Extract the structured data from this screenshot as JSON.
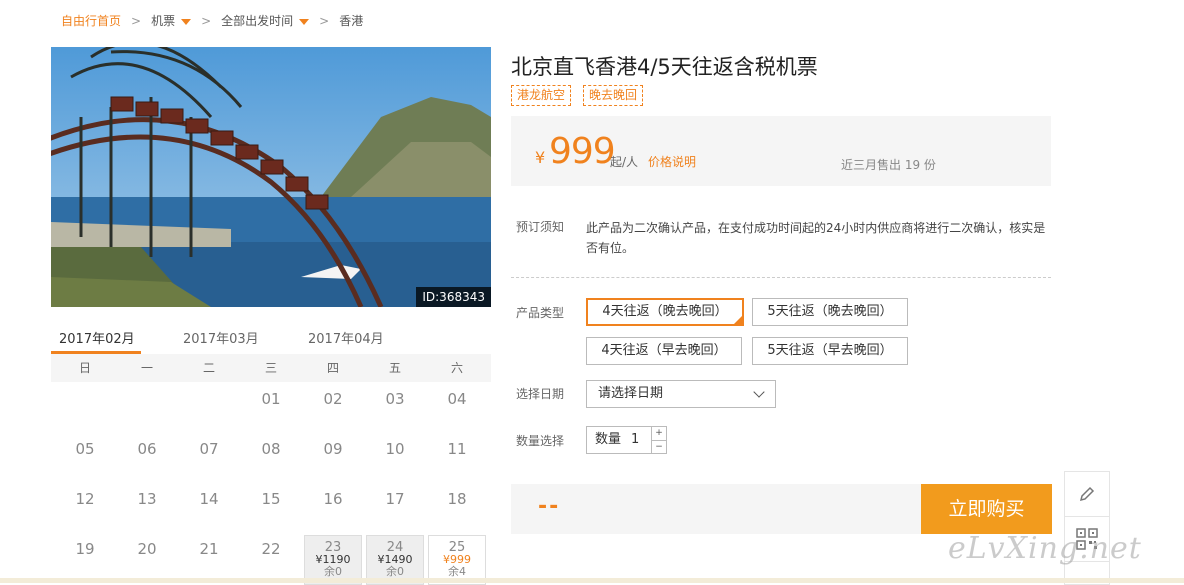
{
  "breadcrumb": {
    "home": "自由行首页",
    "category": "机票",
    "departure": "全部出发时间",
    "destination": "香港"
  },
  "photo": {
    "id_label": "ID:368343"
  },
  "calendar": {
    "months": [
      "2017年02月",
      "2017年03月",
      "2017年04月"
    ],
    "active_month": "2017年02月",
    "weekdays": [
      "日",
      "一",
      "二",
      "三",
      "四",
      "五",
      "六"
    ],
    "days": [
      "01",
      "02",
      "03",
      "04",
      "05",
      "06",
      "07",
      "08",
      "09",
      "10",
      "11",
      "12",
      "13",
      "14",
      "15",
      "16",
      "17",
      "18",
      "19",
      "20",
      "21",
      "22"
    ],
    "priced_days": [
      {
        "day": "23",
        "price": "¥1190",
        "remain": "余0"
      },
      {
        "day": "24",
        "price": "¥1490",
        "remain": "余0"
      },
      {
        "day": "25",
        "price": "¥999",
        "remain": "余4"
      }
    ]
  },
  "product": {
    "title": "北京直飞香港4/5天往返含税机票",
    "tags": [
      "港龙航空",
      "晚去晚回"
    ],
    "currency": "¥",
    "price": "999",
    "price_unit": "起/人",
    "price_note": "价格说明",
    "sold": "近三月售出 19 份"
  },
  "booking": {
    "notice_label": "预订须知",
    "notice_text": "此产品为二次确认产品，在支付成功时间起的24小时内供应商将进行二次确认，核实是否有位。",
    "type_label": "产品类型",
    "types": [
      "4天往返（晚去晚回）",
      "5天往返（晚去晚回）",
      "4天往返（早去晚回）",
      "5天往返（早去晚回）"
    ],
    "date_label": "选择日期",
    "date_placeholder": "请选择日期",
    "qty_label": "数量选择",
    "qty_text": "数量",
    "qty_value": "1",
    "qty_plus": "+",
    "qty_minus": "−",
    "total": "--",
    "buy_label": "立即购买"
  },
  "side": {
    "edit_icon": "pencil-icon",
    "qr_icon": "qrcode-icon"
  },
  "watermark": "eLvXing.net",
  "colors": {
    "accent": "#f0821e",
    "buy_button": "#f29b1d"
  }
}
